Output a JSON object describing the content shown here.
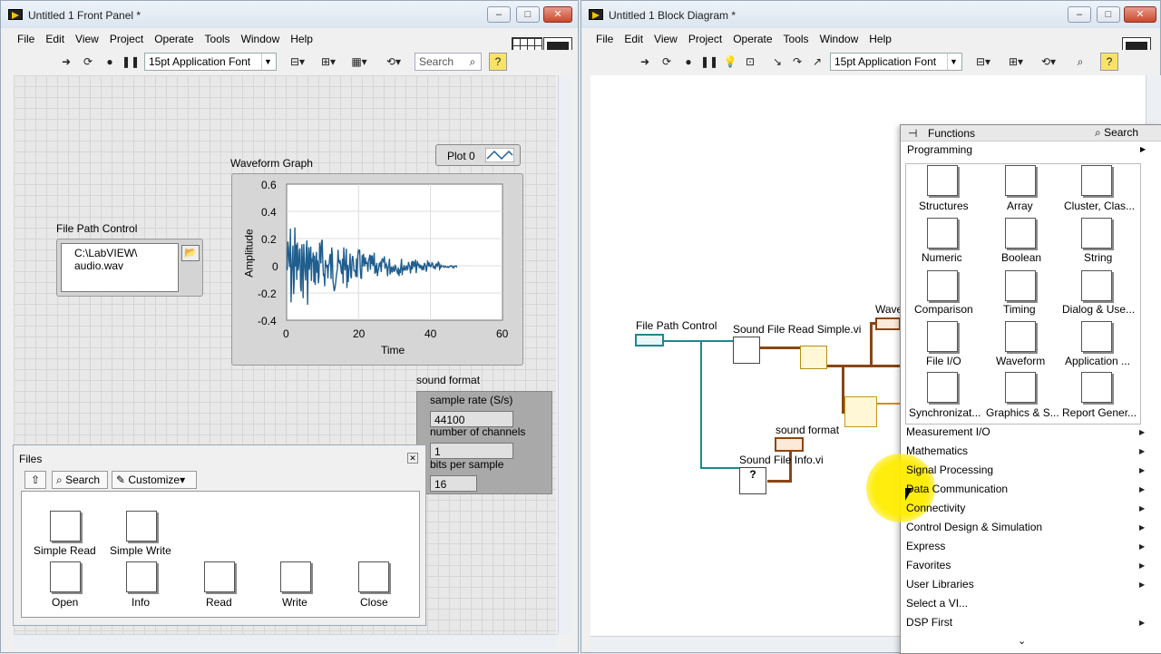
{
  "front_panel": {
    "title": "Untitled 1 Front Panel *",
    "menu": [
      "File",
      "Edit",
      "View",
      "Project",
      "Operate",
      "Tools",
      "Window",
      "Help"
    ],
    "font": "15pt Application Font",
    "search": "Search",
    "file_path_control": {
      "label": "File Path Control",
      "value_line1": "C:\\LabVIEW\\",
      "value_line2": "audio.wav"
    },
    "graph": {
      "label": "Waveform Graph",
      "plot_legend": "Plot 0",
      "xlabel": "Time",
      "ylabel": "Amplitude",
      "yticks": [
        "0.6",
        "0.4",
        "0.2",
        "0",
        "-0.2",
        "-0.4"
      ],
      "xticks": [
        "0",
        "20",
        "40",
        "60"
      ]
    },
    "sound_format": {
      "label": "sound format",
      "sample_rate_label": "sample rate (S/s)",
      "sample_rate": "44100",
      "channels_label": "number of channels",
      "channels": "1",
      "bits_label": "bits per sample",
      "bits": "16"
    }
  },
  "files_palette": {
    "title": "Files",
    "search": "Search",
    "customize": "Customize",
    "items": [
      "Simple Read",
      "Simple Write",
      "Open",
      "Info",
      "Read",
      "Write",
      "Close"
    ]
  },
  "block_diagram": {
    "title": "Untitled 1 Block Diagram *",
    "menu": [
      "File",
      "Edit",
      "View",
      "Project",
      "Operate",
      "Tools",
      "Window",
      "Help"
    ],
    "font": "15pt Application Font",
    "nodes": {
      "file_path": "File Path Control",
      "sound_read": "Sound File Read Simple.vi",
      "sound_format": "sound format",
      "sound_info": "Sound File Info.vi",
      "waveform_partial": "Wave"
    }
  },
  "functions_palette": {
    "title": "Functions",
    "search": "Search",
    "programming": "Programming",
    "grid": [
      "Structures",
      "Array",
      "Cluster, Clas...",
      "Numeric",
      "Boolean",
      "String",
      "Comparison",
      "Timing",
      "Dialog & Use...",
      "File I/O",
      "Waveform",
      "Application ...",
      "Synchronizat...",
      "Graphics & S...",
      "Report Gener..."
    ],
    "categories": [
      "Measurement I/O",
      "Mathematics",
      "Signal Processing",
      "Data Communication",
      "Connectivity",
      "Control Design & Simulation",
      "Express",
      "Favorites",
      "User Libraries",
      "Select a VI...",
      "DSP First"
    ]
  },
  "colors": {
    "wave": "#1f5e8e",
    "highlight": "#ffec00",
    "teal_wire": "#1a8a8a",
    "brown_wire": "#8b4513"
  }
}
